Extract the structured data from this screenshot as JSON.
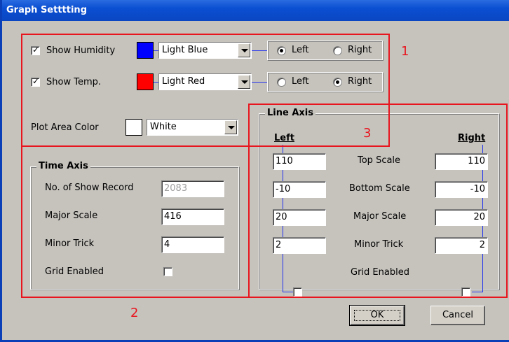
{
  "window": {
    "title": "Graph Setttting"
  },
  "series": {
    "humidity": {
      "label": "Show Humidity",
      "checked": true,
      "color_name": "Light Blue",
      "color": "#0000ff",
      "axis": "Left"
    },
    "temp": {
      "label": "Show Temp.",
      "checked": true,
      "color_name": "Light Red",
      "color": "#ff0000",
      "axis": "Right"
    }
  },
  "radio_labels": {
    "left": "Left",
    "right": "Right"
  },
  "plot_area": {
    "label": "Plot Area Color",
    "color_name": "White",
    "color": "#ffffff"
  },
  "time_axis": {
    "title": "Time Axis",
    "rows": [
      {
        "label": "No. of Show Record",
        "value": "2083"
      },
      {
        "label": "Major Scale",
        "value": "416"
      },
      {
        "label": "Minor Trick",
        "value": "4"
      }
    ],
    "grid_label": "Grid Enabled"
  },
  "line_axis": {
    "title": "Line Axis",
    "left_header": "Left",
    "right_header": "Right",
    "rows": [
      {
        "label": "Top Scale",
        "left": "110",
        "right": "110"
      },
      {
        "label": "Bottom Scale",
        "left": "-10",
        "right": "-10"
      },
      {
        "label": "Major Scale",
        "left": "20",
        "right": "20"
      },
      {
        "label": "Minor Trick",
        "left": "2",
        "right": "2"
      }
    ],
    "grid_label": "Grid Enabled"
  },
  "annotations": {
    "one": "1",
    "two": "2",
    "three": "3"
  },
  "buttons": {
    "ok": "OK",
    "cancel": "Cancel"
  },
  "accent_colors": {
    "annotation_red": "#e8151e",
    "connector_blue": "#2233ee",
    "titlebar": "#0b4fd2"
  }
}
